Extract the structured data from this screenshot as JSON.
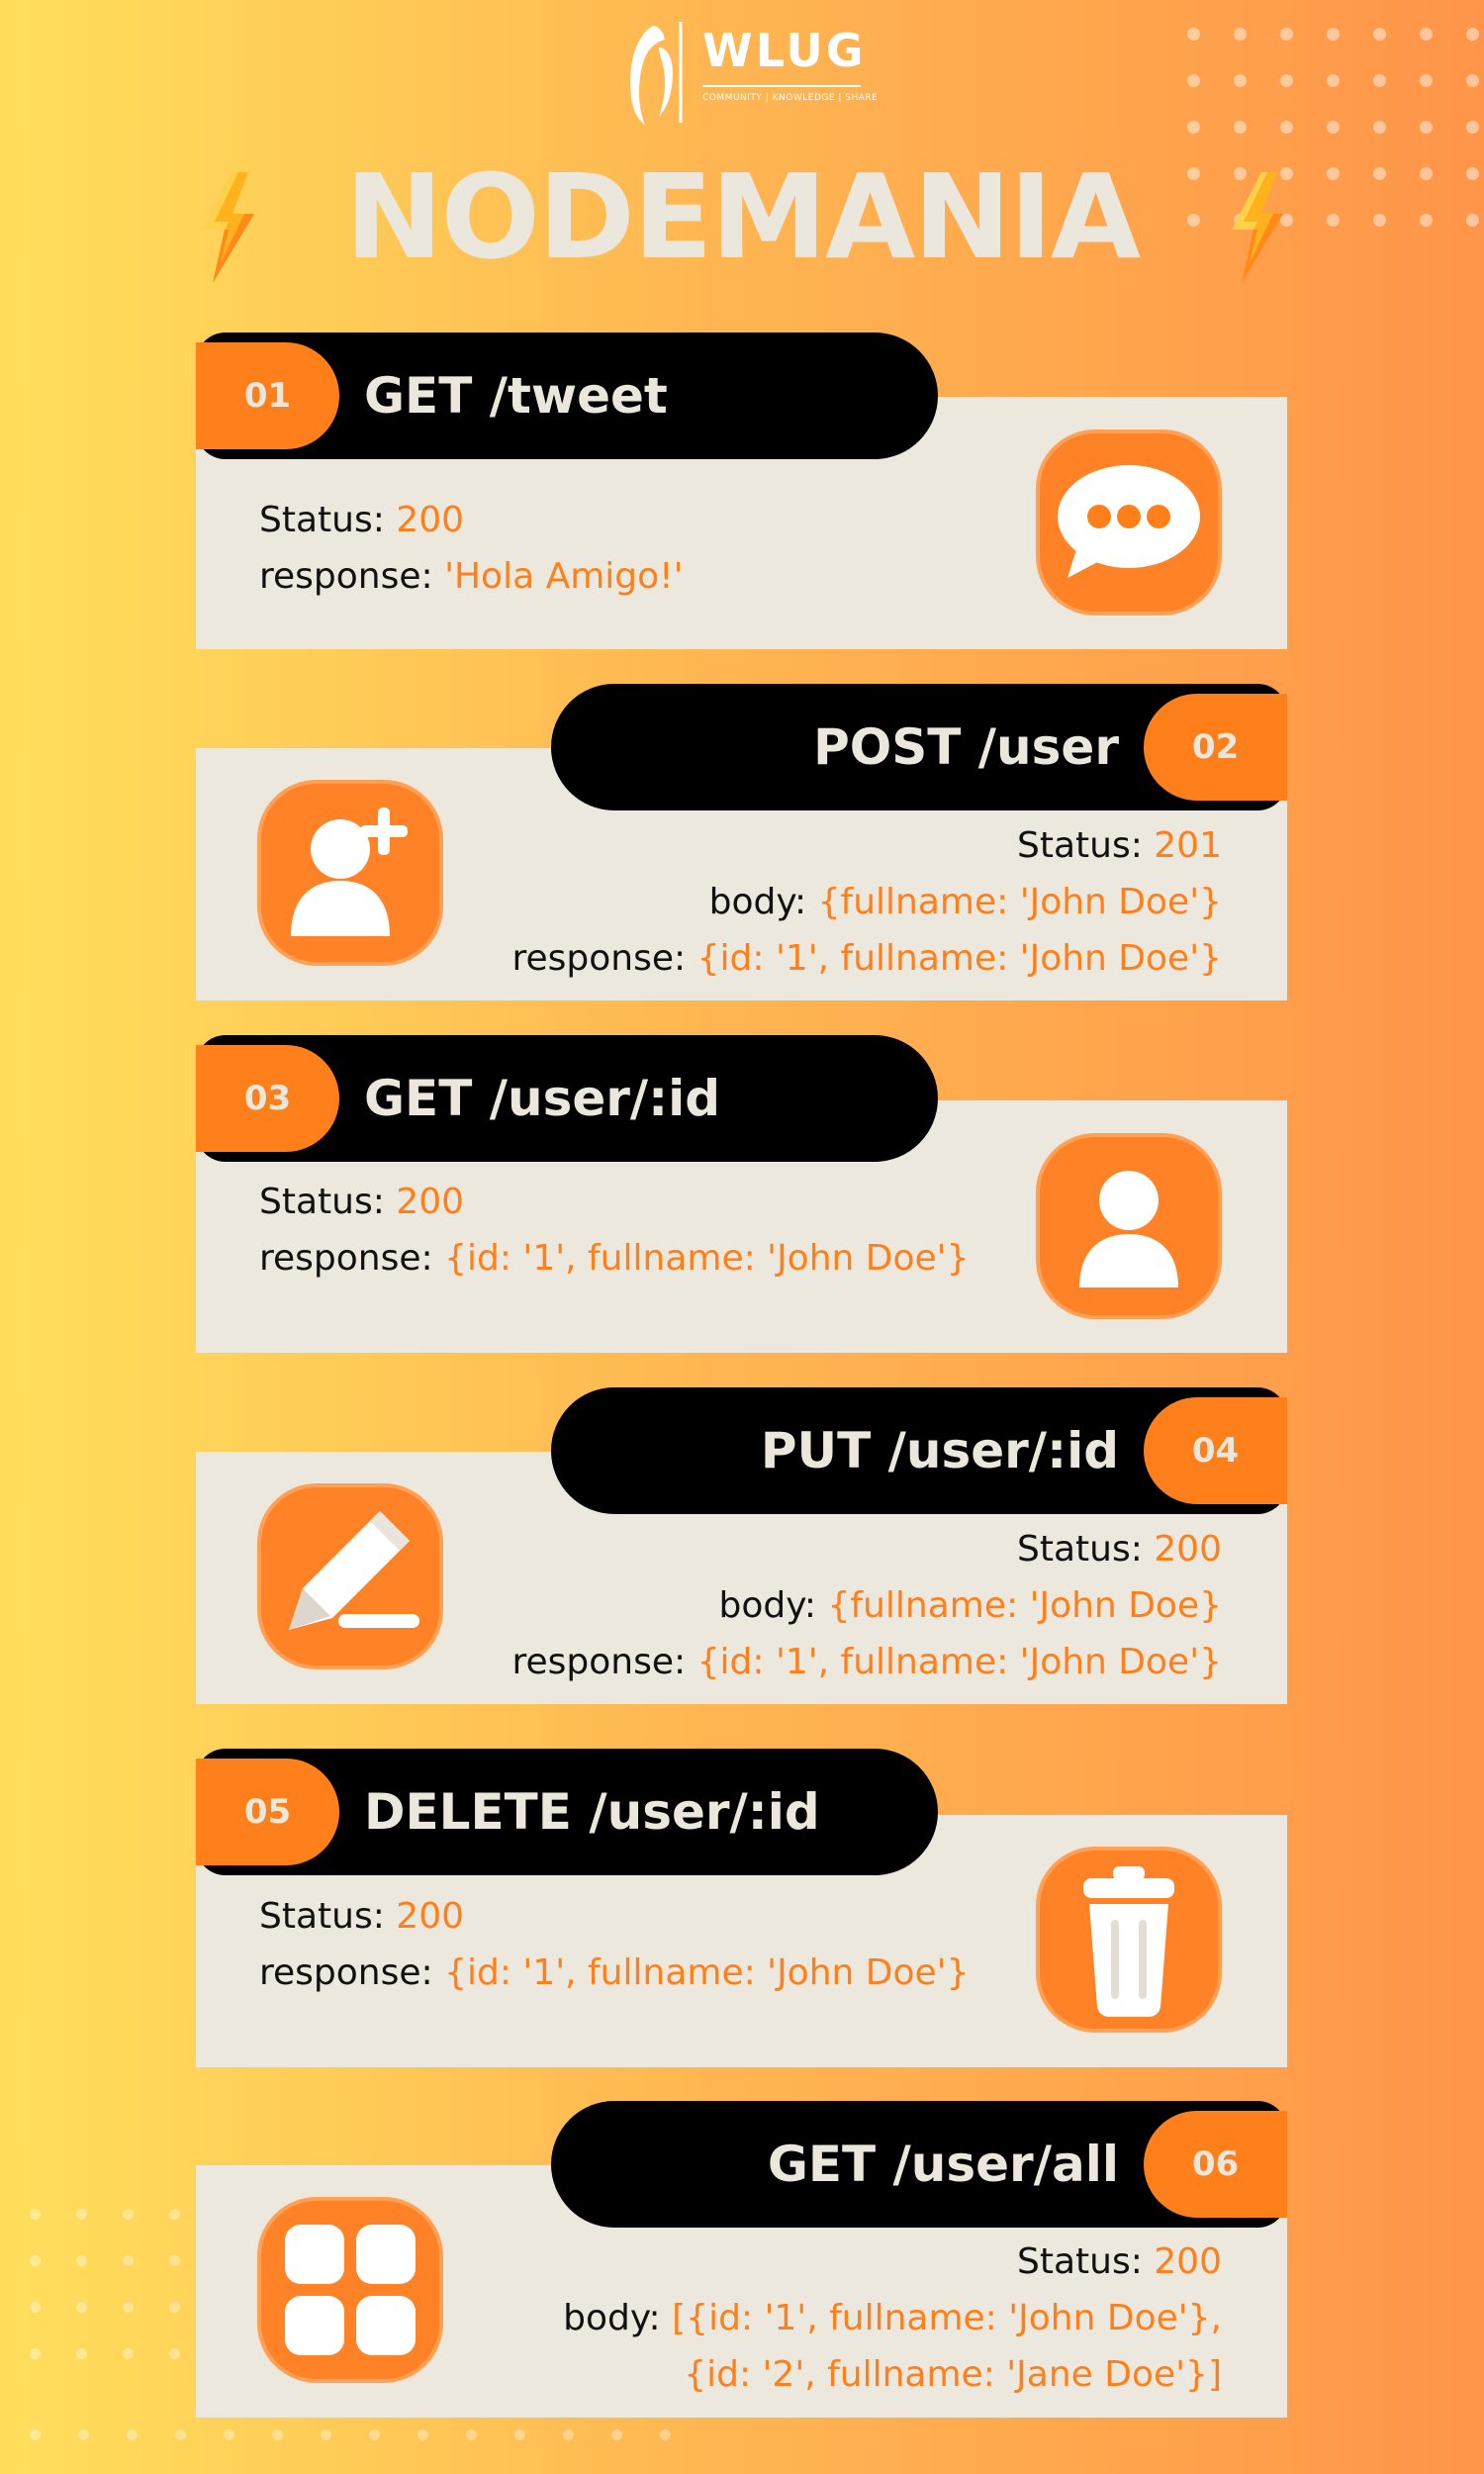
{
  "logo": {
    "name": "WLUG",
    "tagline": "COMMUNITY | KNOWLEDGE | SHARE"
  },
  "title": "NODEMANIA",
  "colors": {
    "accent": "#ff7f1a",
    "card_bg": "#ece8de",
    "pill_bg": "#000000",
    "light_text": "#ece7dd"
  },
  "endpoints": [
    {
      "number": "01",
      "endpoint": "GET /tweet",
      "icon": "chat-bubble-icon",
      "lines": [
        {
          "label": "Status:",
          "value": "200"
        },
        {
          "label": "response:",
          "value": "'Hola Amigo!'"
        }
      ]
    },
    {
      "number": "02",
      "endpoint": "POST /user",
      "icon": "add-user-icon",
      "lines": [
        {
          "label": "Status:",
          "value": "201"
        },
        {
          "label": "body:",
          "value": "{fullname: 'John Doe'}"
        },
        {
          "label": "response:",
          "value": "{id: '1', fullname: 'John Doe'}"
        }
      ]
    },
    {
      "number": "03",
      "endpoint": "GET /user/:id",
      "icon": "user-icon",
      "lines": [
        {
          "label": "Status:",
          "value": "200"
        },
        {
          "label": "response:",
          "value": "{id: '1', fullname: 'John Doe'}"
        }
      ]
    },
    {
      "number": "04",
      "endpoint": "PUT /user/:id",
      "icon": "pencil-edit-icon",
      "lines": [
        {
          "label": "Status:",
          "value": "200"
        },
        {
          "label": "body:",
          "value": "{fullname: 'John Doe}"
        },
        {
          "label": "response:",
          "value": "{id: '1', fullname: 'John Doe'}"
        }
      ]
    },
    {
      "number": "05",
      "endpoint": "DELETE /user/:id",
      "icon": "trash-icon",
      "lines": [
        {
          "label": "Status:",
          "value": "200"
        },
        {
          "label": "response:",
          "value": "{id: '1', fullname: 'John Doe'}"
        }
      ]
    },
    {
      "number": "06",
      "endpoint": "GET /user/all",
      "icon": "grid-apps-icon",
      "lines": [
        {
          "label": "Status:",
          "value": "200"
        },
        {
          "label": "body:",
          "value": "[{id: '1', fullname: 'John Doe'},"
        },
        {
          "label": "",
          "value": "{id: '2', fullname: 'Jane Doe'}]"
        }
      ]
    }
  ]
}
